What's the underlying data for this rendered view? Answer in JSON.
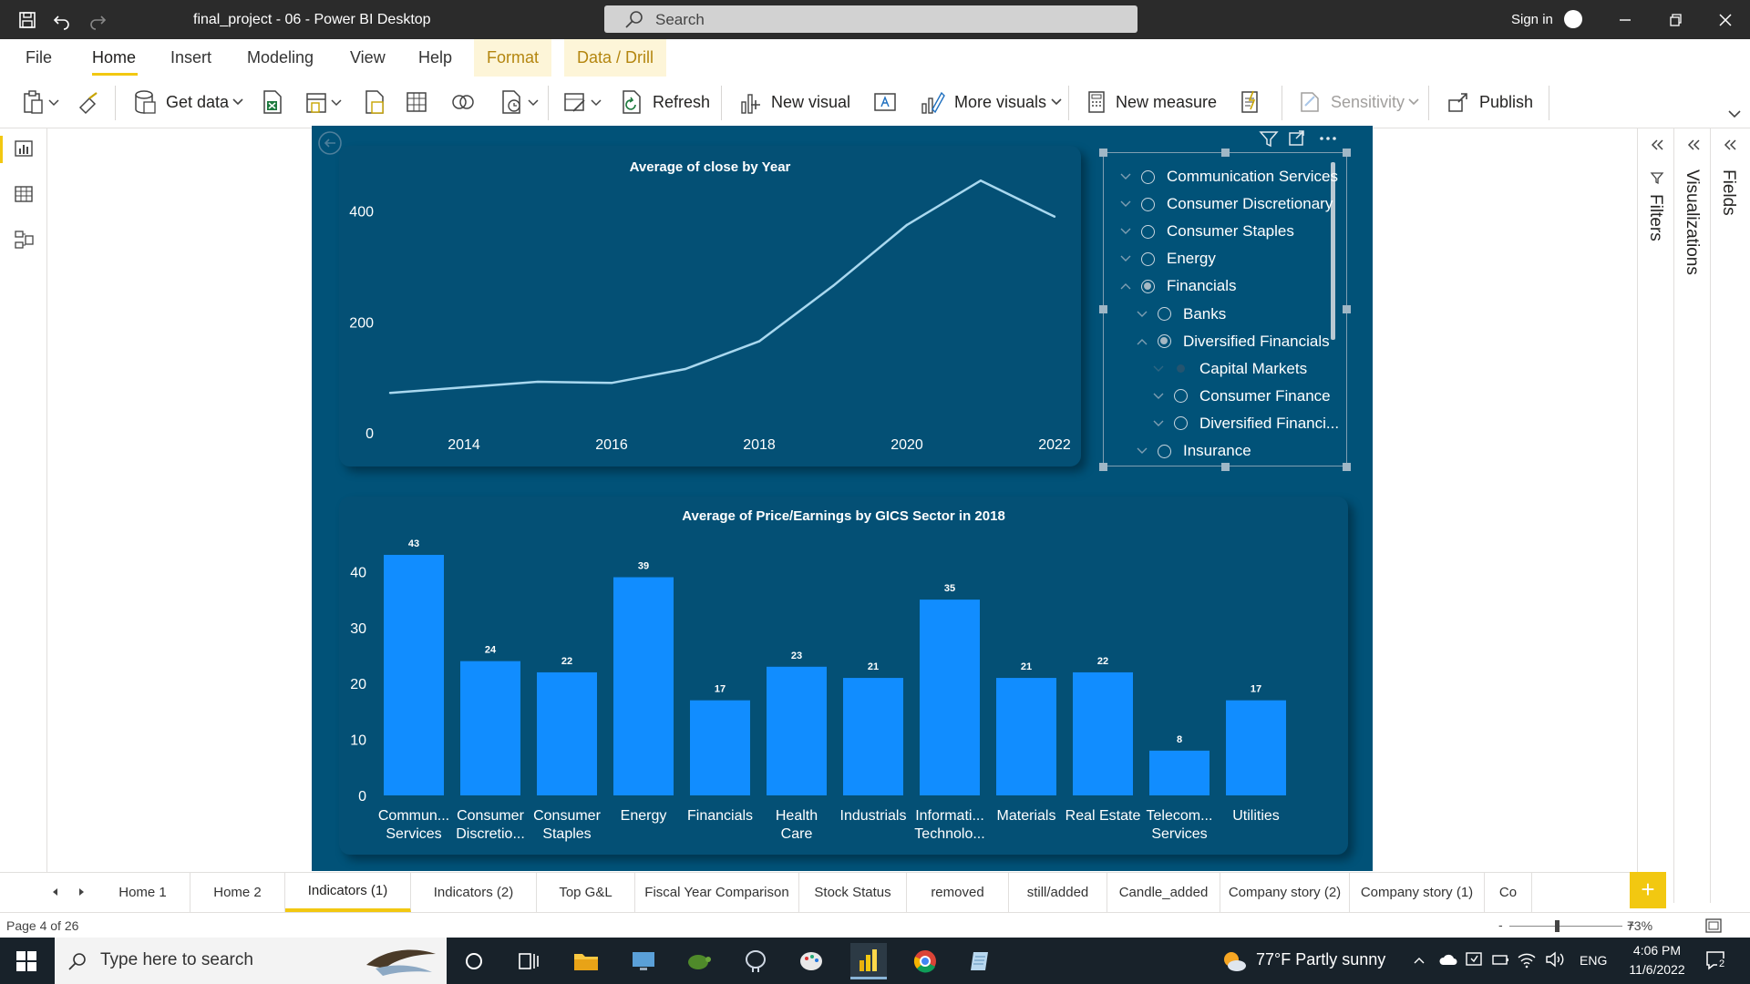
{
  "window": {
    "title": "final_project - 06 - Power BI Desktop",
    "search_label": "Search",
    "sign_in": "Sign in"
  },
  "menu": {
    "file": "File",
    "home": "Home",
    "insert": "Insert",
    "modeling": "Modeling",
    "view": "View",
    "help": "Help",
    "format": "Format",
    "data_drill": "Data / Drill"
  },
  "ribbon": {
    "get_data": "Get data",
    "refresh": "Refresh",
    "new_visual": "New visual",
    "more_visuals": "More visuals",
    "new_measure": "New measure",
    "sensitivity": "Sensitivity",
    "publish": "Publish"
  },
  "panes": {
    "filters": "Filters",
    "visualizations": "Visualizations",
    "fields": "Fields"
  },
  "slicer": {
    "items": [
      {
        "label": "Communication Services",
        "level": 0,
        "expanded": false,
        "state": "off"
      },
      {
        "label": "Consumer Discretionary",
        "level": 0,
        "expanded": false,
        "state": "off"
      },
      {
        "label": "Consumer Staples",
        "level": 0,
        "expanded": false,
        "state": "off"
      },
      {
        "label": "Energy",
        "level": 0,
        "expanded": false,
        "state": "off"
      },
      {
        "label": "Financials",
        "level": 0,
        "expanded": true,
        "state": "partial"
      },
      {
        "label": "Banks",
        "level": 1,
        "expanded": false,
        "state": "off"
      },
      {
        "label": "Diversified Financials",
        "level": 1,
        "expanded": true,
        "state": "partial"
      },
      {
        "label": "Capital Markets",
        "level": 2,
        "expanded": false,
        "state": "selected"
      },
      {
        "label": "Consumer Finance",
        "level": 2,
        "expanded": false,
        "state": "off"
      },
      {
        "label": "Diversified Financi...",
        "level": 2,
        "expanded": false,
        "state": "off"
      },
      {
        "label": "Insurance",
        "level": 1,
        "expanded": false,
        "state": "off"
      }
    ]
  },
  "chart_data": [
    {
      "type": "line",
      "title": "Average of close by Year",
      "x": [
        2013,
        2014,
        2015,
        2016,
        2017,
        2018,
        2019,
        2020,
        2021,
        2022
      ],
      "series": [
        {
          "values": [
            72,
            82,
            92,
            90,
            115,
            165,
            265,
            375,
            455,
            390
          ]
        }
      ],
      "x_ticks": [
        "2014",
        "2016",
        "2018",
        "2020",
        "2022"
      ],
      "y_ticks": [
        "0",
        "200",
        "400"
      ],
      "ylim": [
        0,
        480
      ],
      "xlim": [
        2013,
        2022
      ],
      "line_color": "#a9d8ef",
      "grid": false
    },
    {
      "type": "bar",
      "title": "Average of Price/Earnings by GICS Sector in 2018",
      "categories": [
        [
          "Commun...",
          "Services"
        ],
        [
          "Consumer",
          "Discretio..."
        ],
        [
          "Consumer",
          "Staples"
        ],
        [
          "Energy"
        ],
        [
          "Financials"
        ],
        [
          "Health",
          "Care"
        ],
        [
          "Industrials"
        ],
        [
          "Informati...",
          "Technolo..."
        ],
        [
          "Materials"
        ],
        [
          "Real Estate"
        ],
        [
          "Telecom...",
          "Services"
        ],
        [
          "Utilities"
        ]
      ],
      "values": [
        43,
        24,
        22,
        39,
        17,
        23,
        21,
        35,
        21,
        22,
        8,
        17
      ],
      "data_labels": [
        "43",
        "24",
        "22",
        "39",
        "17",
        "23",
        "21",
        "35",
        "21",
        "22",
        "8",
        "17"
      ],
      "y_ticks": [
        "0",
        "10",
        "20",
        "30",
        "40"
      ],
      "ylim": [
        0,
        43
      ],
      "bar_color": "#118dff",
      "grid": false
    }
  ],
  "tabs": [
    "Home 1",
    "Home 2",
    "Indicators (1)",
    "Indicators (2)",
    "Top G&L",
    "Fiscal Year Comparison",
    "Stock Status",
    "removed",
    "still/added",
    "Candle_added",
    "Company story (2)",
    "Company story (1)",
    "Co"
  ],
  "active_tab": "Indicators (1)",
  "status": {
    "page": "Page 4 of 26",
    "zoom": "73%",
    "zoom_minus": "-",
    "zoom_plus": "+"
  },
  "taskbar": {
    "search_placeholder": "Type here to search",
    "weather": "77°F  Partly sunny",
    "lang": "ENG",
    "time": "4:06 PM",
    "date": "11/6/2022",
    "notifications": "2"
  },
  "colors": {
    "accent": "#f2c811",
    "page_bg": "#015278",
    "visual_bg": "#045075",
    "bar": "#118dff"
  }
}
